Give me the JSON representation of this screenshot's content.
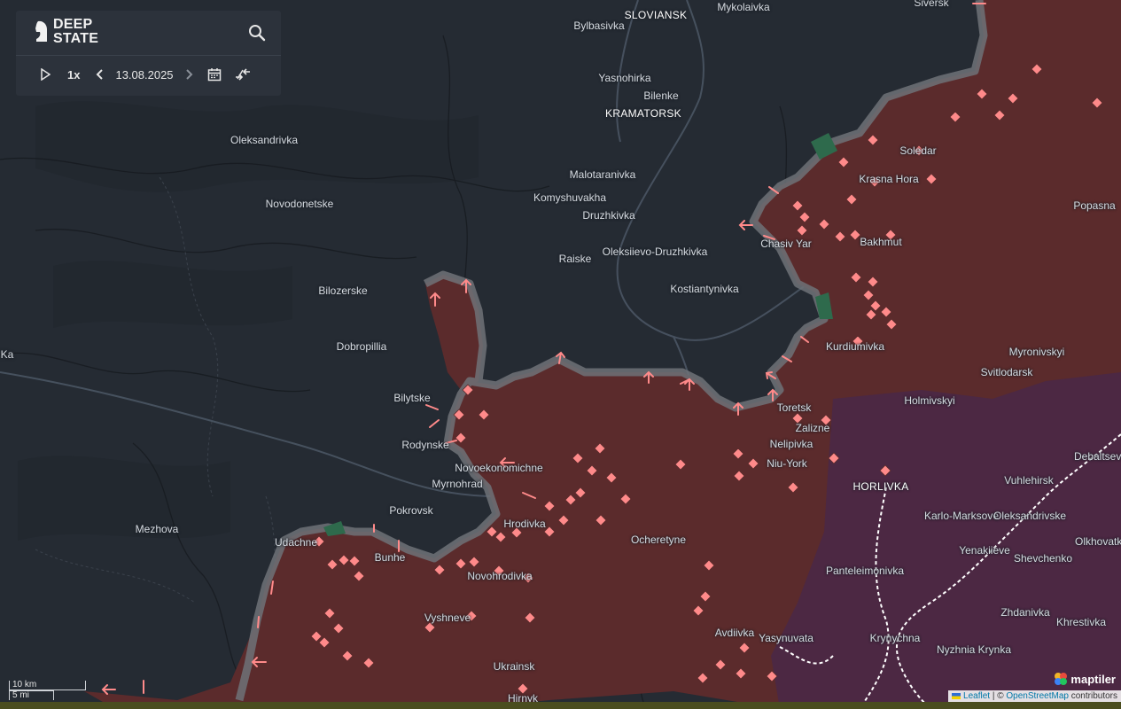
{
  "app": {
    "logo_line1": "DEEP",
    "logo_line2": "STATE"
  },
  "controls": {
    "speed": "1x",
    "date": "13.08.2025"
  },
  "icons": {
    "logo": "knight-icon",
    "search": "search-icon",
    "play": "play-icon",
    "prev": "chevron-left-icon",
    "next": "chevron-right-icon",
    "calendar": "calendar-icon",
    "compare": "compare-arrows-icon"
  },
  "colors": {
    "background": "#252b33",
    "occupied": "#5b2b2c",
    "contested": "#6f7278",
    "crimea_held": "#4c2843",
    "markers": "#ff8a8a",
    "border": "#ffffff"
  },
  "places": [
    {
      "name": "SLOVIANSK",
      "big": true
    },
    {
      "name": "Mykolaivka"
    },
    {
      "name": "Siversk"
    },
    {
      "name": "Bylbasivka"
    },
    {
      "name": "Yasnohirka"
    },
    {
      "name": "Bilenke"
    },
    {
      "name": "KRAMATORSK",
      "big": true
    },
    {
      "name": "Oleksandrivka"
    },
    {
      "name": "Malotaranivka"
    },
    {
      "name": "Soledar"
    },
    {
      "name": "Komyshuvakha"
    },
    {
      "name": "Krasna Hora"
    },
    {
      "name": "Novodonetske"
    },
    {
      "name": "Druzhkivka"
    },
    {
      "name": "Popasna"
    },
    {
      "name": "Chasiv Yar"
    },
    {
      "name": "Bakhmut"
    },
    {
      "name": "Oleksiievo-Druzhkivka"
    },
    {
      "name": "Raiske"
    },
    {
      "name": "Kostiantynivka"
    },
    {
      "name": "Bilozerske"
    },
    {
      "name": "Kurdiumivka"
    },
    {
      "name": "Dobropillia"
    },
    {
      "name": "Myronivskyi"
    },
    {
      "name": "Svitlodarsk"
    },
    {
      "name": "Bilytske"
    },
    {
      "name": "Holmivskyi"
    },
    {
      "name": "Toretsk"
    },
    {
      "name": "Zalizne"
    },
    {
      "name": "Nelipivka"
    },
    {
      "name": "Rodynske"
    },
    {
      "name": "Niu-York"
    },
    {
      "name": "Debaltseve"
    },
    {
      "name": "Novoekonomichne"
    },
    {
      "name": "Vuhlehirsk"
    },
    {
      "name": "HORLIVKA",
      "big": true
    },
    {
      "name": "Myrnohrad"
    },
    {
      "name": "Pokrovsk"
    },
    {
      "name": "Karlo-Marksove"
    },
    {
      "name": "Oleksandrivske"
    },
    {
      "name": "Hrodivka"
    },
    {
      "name": "Mezhova"
    },
    {
      "name": "Ocheretyne"
    },
    {
      "name": "Udachne"
    },
    {
      "name": "Olkhovatka"
    },
    {
      "name": "Yenakiieve"
    },
    {
      "name": "Shevchenko"
    },
    {
      "name": "Bunhe"
    },
    {
      "name": "Panteleimonivka"
    },
    {
      "name": "Novohrodivka"
    },
    {
      "name": "Zhdanivka"
    },
    {
      "name": "Vyshneve"
    },
    {
      "name": "Khrestivka"
    },
    {
      "name": "Avdiivka"
    },
    {
      "name": "Yasynuvata"
    },
    {
      "name": "Krynychna"
    },
    {
      "name": "Nyzhnia Krynka"
    },
    {
      "name": "Ukrainsk"
    },
    {
      "name": "Hirnyk"
    },
    {
      "name": "Ka"
    }
  ],
  "scale": {
    "km": "10 km",
    "mi": "5 mi"
  },
  "attribution": {
    "leaflet": "Leaflet",
    "sep": " | © ",
    "osm": "OpenStreetMap",
    "rest": " contributors"
  },
  "maptiler": "maptiler"
}
